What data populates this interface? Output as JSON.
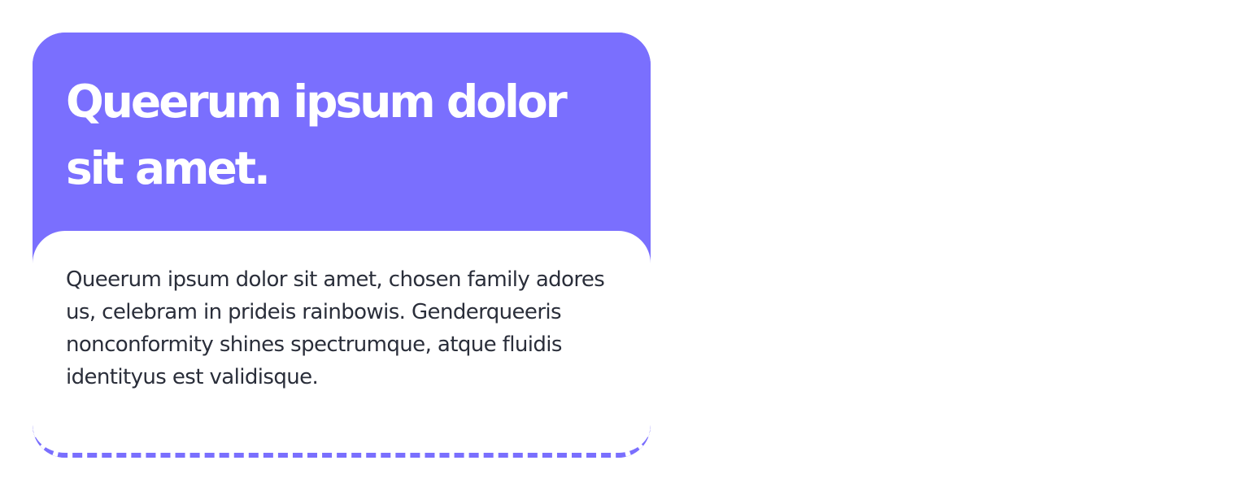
{
  "card": {
    "title": "Queerum ipsum dolor sit amet.",
    "body": "Queerum ipsum dolor sit amet, chosen family adores us, celebram in prideis rainbowis. Genderqueeris nonconformity shines spectrumque, atque fluidis identityus est validisque.",
    "accent_color": "#7a6ffe",
    "text_color": "#2a2e3a"
  }
}
